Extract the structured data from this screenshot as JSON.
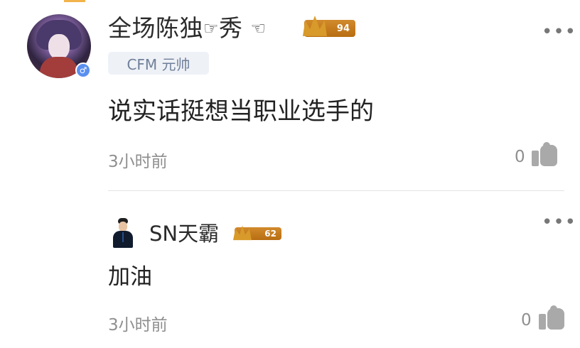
{
  "main_comment": {
    "username_part1": "全场陈独",
    "username_part2": "秀",
    "level": "94",
    "tag": "CFM 元帅",
    "content": "说实话挺想当职业选手的",
    "time": "3小时前",
    "likes": "0",
    "gender_symbol": "♂",
    "more_icon": "•••"
  },
  "reply_comment": {
    "username": "SN天霸",
    "level": "62",
    "content": "加油",
    "time": "3小时前",
    "likes": "0",
    "more_icon": "•••"
  },
  "icons": {
    "hand": "☞",
    "hand_alt": "☜"
  },
  "colors": {
    "badge_gold": "#c67a1a",
    "tag_bg": "#eef1f6",
    "tag_text": "#6f7f99",
    "gender_blue": "#5a8ff0",
    "muted_text": "#8f8f8f"
  }
}
